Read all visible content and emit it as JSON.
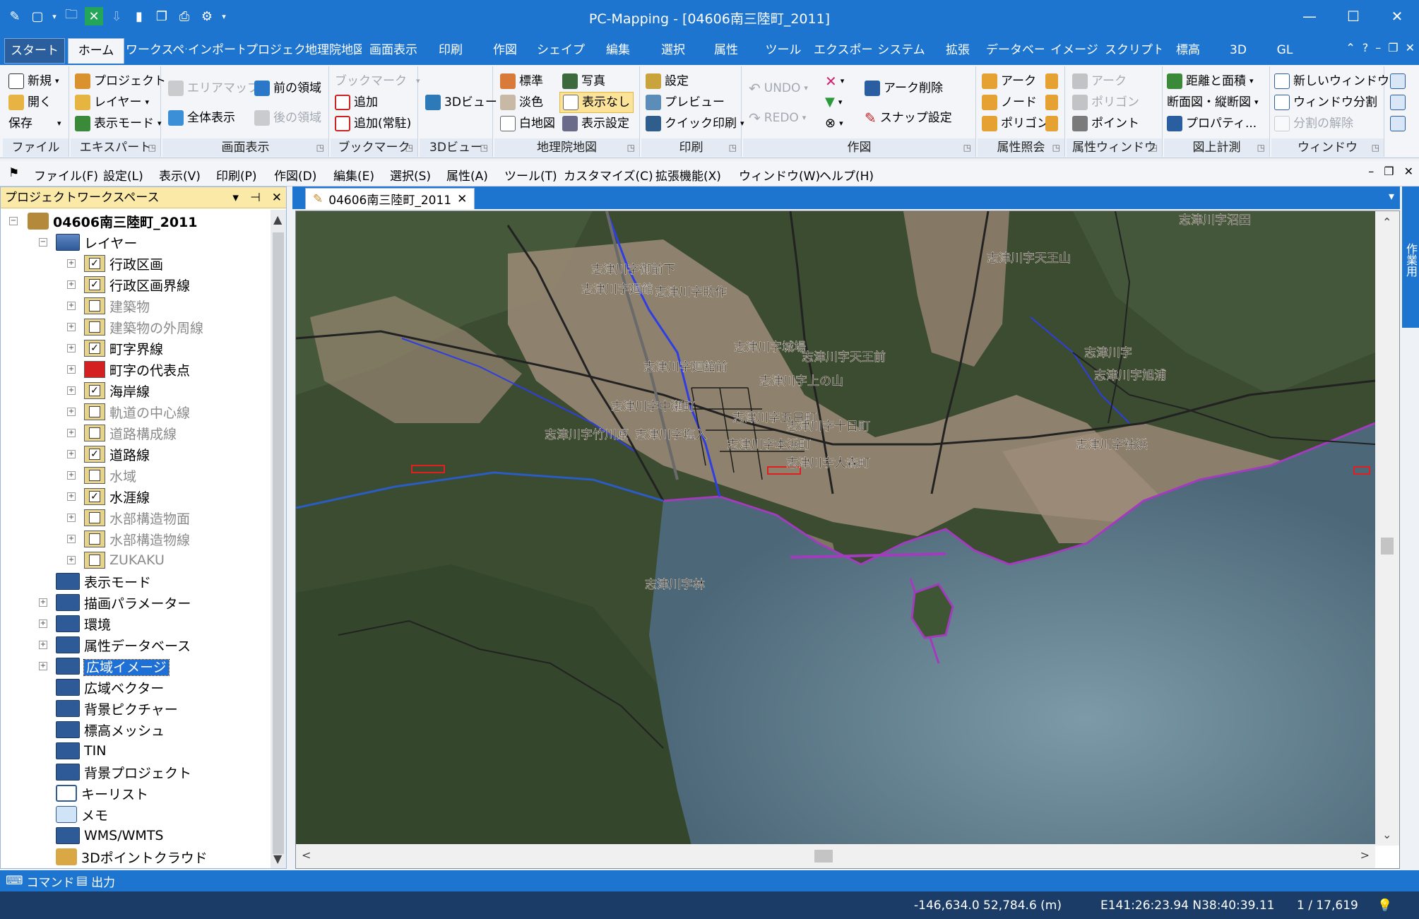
{
  "app": {
    "title": "PC-Mapping - [04606南三陸町_2011]",
    "accent": "#1e75d0"
  },
  "ribbon_tabs": [
    "スタート",
    "ホーム",
    "ワークスペー",
    "インポート",
    "プロジェクト",
    "地理院地図",
    "画面表示",
    "印刷",
    "作図",
    "シェイプ",
    "編集",
    "選択",
    "属性",
    "ツール",
    "エクスポート",
    "システム",
    "拡張",
    "データベース",
    "イメージ",
    "スクリプト",
    "標高",
    "3D",
    "GL"
  ],
  "ribbon": {
    "file": {
      "label": "ファイル",
      "new": "新規",
      "open": "開く",
      "save": "保存"
    },
    "expert": {
      "label": "エキスパート",
      "project": "プロジェクト",
      "layer": "レイヤー",
      "display_mode": "表示モード"
    },
    "screen": {
      "label": "画面表示",
      "area_map": "エリアマップ",
      "full_view": "全体表示",
      "prev_area": "前の領域",
      "next_area": "後の領域"
    },
    "bookmark": {
      "label": "ブックマーク",
      "bookmark": "ブックマーク",
      "add": "追加",
      "add_resident": "追加(常駐)"
    },
    "view3d": {
      "label": "3Dビュー",
      "view": "3Dビュー"
    },
    "gsi": {
      "label": "地理院地図",
      "standard": "標準",
      "pale": "淡色",
      "blank": "白地図",
      "photo": "写真",
      "hide": "表示なし",
      "display_settings": "表示設定"
    },
    "print": {
      "label": "印刷",
      "settings": "設定",
      "preview": "プレビュー",
      "quick_print": "クイック印刷"
    },
    "draw": {
      "label": "作図",
      "undo": "UNDO",
      "redo": "REDO",
      "arc_delete": "アーク削除",
      "snap_settings": "スナップ設定"
    },
    "attr_query": {
      "label": "属性照会",
      "arc": "アーク",
      "node": "ノード",
      "polygon": "ポリゴン"
    },
    "attr_window": {
      "label": "属性ウィンドウ",
      "arc": "アーク",
      "polygon": "ポリゴン",
      "point": "ポイント"
    },
    "measure": {
      "label": "図上計測",
      "distance_area": "距離と面積",
      "cross_section": "断面図・縦断図",
      "property": "プロパティ..."
    },
    "window": {
      "label": "ウィンドウ",
      "new_window": "新しいウィンドウ",
      "split": "ウィンドウ分割",
      "unsplit": "分割の解除"
    }
  },
  "menubar": [
    "ファイル(F)",
    "設定(L)",
    "表示(V)",
    "印刷(P)",
    "作図(D)",
    "編集(E)",
    "選択(S)",
    "属性(A)",
    "ツール(T)",
    "カスタマイズ(C)",
    "拡張機能(X)",
    "ウィンドウ(W)",
    "ヘルプ(H)"
  ],
  "workspace": {
    "title": "プロジェクトワークスペース",
    "root": "04606南三陸町_2011",
    "layers_folder": "レイヤー",
    "layers": [
      {
        "name": "行政区画",
        "checked": true,
        "dim": false
      },
      {
        "name": "行政区画界線",
        "checked": true,
        "dim": false
      },
      {
        "name": "建築物",
        "checked": false,
        "dim": true
      },
      {
        "name": "建築物の外周線",
        "checked": false,
        "dim": true
      },
      {
        "name": "町字界線",
        "checked": true,
        "dim": false
      },
      {
        "name": "町字の代表点",
        "checked": false,
        "dim": false,
        "red": true
      },
      {
        "name": "海岸線",
        "checked": true,
        "dim": false
      },
      {
        "name": "軌道の中心線",
        "checked": false,
        "dim": true
      },
      {
        "name": "道路構成線",
        "checked": false,
        "dim": true
      },
      {
        "name": "道路線",
        "checked": true,
        "dim": false
      },
      {
        "name": "水域",
        "checked": false,
        "dim": true
      },
      {
        "name": "水涯線",
        "checked": true,
        "dim": false
      },
      {
        "name": "水部構造物面",
        "checked": false,
        "dim": true
      },
      {
        "name": "水部構造物線",
        "checked": false,
        "dim": true
      },
      {
        "name": "ZUKAKU",
        "checked": false,
        "dim": true
      }
    ],
    "folders": [
      {
        "name": "表示モード",
        "expandable": false
      },
      {
        "name": "描画パラメーター",
        "expandable": true
      },
      {
        "name": "環境",
        "expandable": true
      },
      {
        "name": "属性データベース",
        "expandable": true
      },
      {
        "name": "広域イメージ",
        "expandable": true,
        "selected": true
      },
      {
        "name": "広域ベクター",
        "expandable": false
      },
      {
        "name": "背景ピクチャー",
        "expandable": false
      },
      {
        "name": "標高メッシュ",
        "expandable": false
      },
      {
        "name": "TIN",
        "expandable": false
      },
      {
        "name": "背景プロジェクト",
        "expandable": false
      },
      {
        "name": "キーリスト",
        "expandable": false,
        "icon": "keylist"
      },
      {
        "name": "メモ",
        "expandable": false,
        "icon": "memo"
      },
      {
        "name": "WMS/WMTS",
        "expandable": false
      },
      {
        "name": "3Dポイントクラウド",
        "expandable": false,
        "icon": "pointcloud"
      }
    ]
  },
  "document": {
    "tab": "04606南三陸町_2011"
  },
  "map_labels": [
    "志津川字沼田",
    "志津川字天王山",
    "志津川字御前下",
    "志津川字廻館",
    "志津川字助作",
    "志津川字城場",
    "志津川字天王前",
    "志津川字廻舘前",
    "志津川字上の山",
    "志津川字中瀬町",
    "志津川字五日町",
    "志津川字十日町",
    "志津川字竹川原",
    "志津川字塩入",
    "志津川字本浜町",
    "志津川字大森町",
    "志津川字旭浦",
    "志津川字",
    "志津川字林",
    "志津川字袖浜"
  ],
  "side_panel": "作業用",
  "bottom_tabs": [
    "コマンド",
    "出力"
  ],
  "status": {
    "coords_m": "-146,634.0 52,784.6 (m)",
    "lonlat": "E141:26:23.94 N38:40:39.11",
    "page": "1 / 17,619"
  }
}
